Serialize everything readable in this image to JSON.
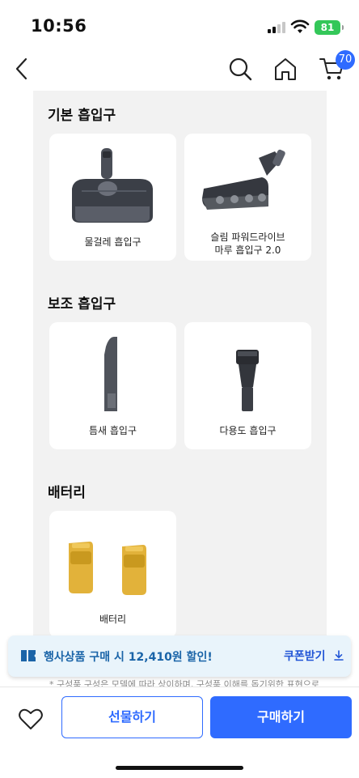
{
  "status_bar": {
    "time": "10:56",
    "battery": "81"
  },
  "nav": {
    "cart_count": "70"
  },
  "sections": [
    {
      "title": "기본 흡입구",
      "items": [
        {
          "name": "물걸레 흡입구"
        },
        {
          "name": "슬림 파워드라이브\n마루 흡입구 2.0"
        }
      ]
    },
    {
      "title": "보조 흡입구",
      "items": [
        {
          "name": "틈새 흡입구"
        },
        {
          "name": "다용도 흡입구"
        }
      ]
    },
    {
      "title": "배터리",
      "items": [
        {
          "name": "배터리"
        }
      ]
    }
  ],
  "coupon": {
    "text": "행사상품 구매 시 12,410원 할인!",
    "button": "쿠폰받기"
  },
  "disclaimer": "* 구성품 구성은 모델에 따라 상이하며, 구성품 이해를 돕기위한 표현으로",
  "bottom": {
    "gift_label": "선물하기",
    "buy_label": "구매하기"
  },
  "colors": {
    "accent": "#2f6bff",
    "coupon_bg": "#e9f4fb",
    "battery": "#34c759",
    "content_bg": "#f2f2f2"
  }
}
